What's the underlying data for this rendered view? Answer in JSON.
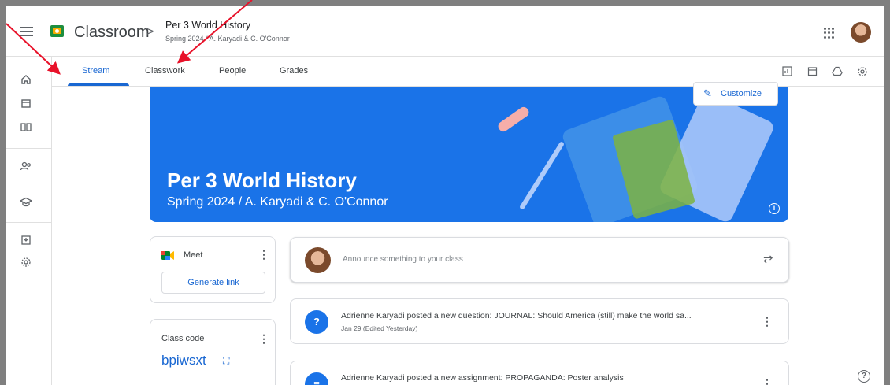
{
  "header": {
    "app_name": "Classroom",
    "breadcrumb_separator": ">",
    "class_title": "Per 3 World History",
    "class_subtitle": "Spring 2024 / A. Karyadi & C. O'Connor",
    "icons": [
      "menu-icon",
      "classroom-logo-icon",
      "apps-grid-icon",
      "account-avatar"
    ]
  },
  "rail": {
    "icons": [
      "home-icon",
      "calendar-icon",
      "enrolled-classes-icon",
      "people-icon",
      "teaching-icon",
      "archive-icon",
      "settings-icon"
    ]
  },
  "tabs": {
    "stream": "Stream",
    "classwork": "Classwork",
    "people": "People",
    "grades": "Grades",
    "active": "Stream",
    "tool_icons": [
      "gradebook-icon",
      "calendar-icon",
      "drive-icon",
      "settings-icon"
    ]
  },
  "banner": {
    "title": "Per 3 World History",
    "subtitle": "Spring 2024 / A. Karyadi & C. O'Connor",
    "customize_label": "Customize",
    "color": "#1a73e8"
  },
  "meet": {
    "label": "Meet",
    "button": "Generate link"
  },
  "class_code": {
    "label": "Class code",
    "value": "bpiwsxt"
  },
  "announce": {
    "placeholder": "Announce something to your class"
  },
  "posts": [
    {
      "title": "Adrienne Karyadi posted a new question: JOURNAL: Should America (still) make the world sa...",
      "date": "Jan 29 (Edited Yesterday)",
      "icon": "question-icon"
    },
    {
      "title": "Adrienne Karyadi posted a new assignment: PROPAGANDA: Poster analysis",
      "icon": "assignment-icon"
    }
  ],
  "colors": {
    "accent": "#1967d2",
    "annotation_arrow": "#e8122a"
  }
}
